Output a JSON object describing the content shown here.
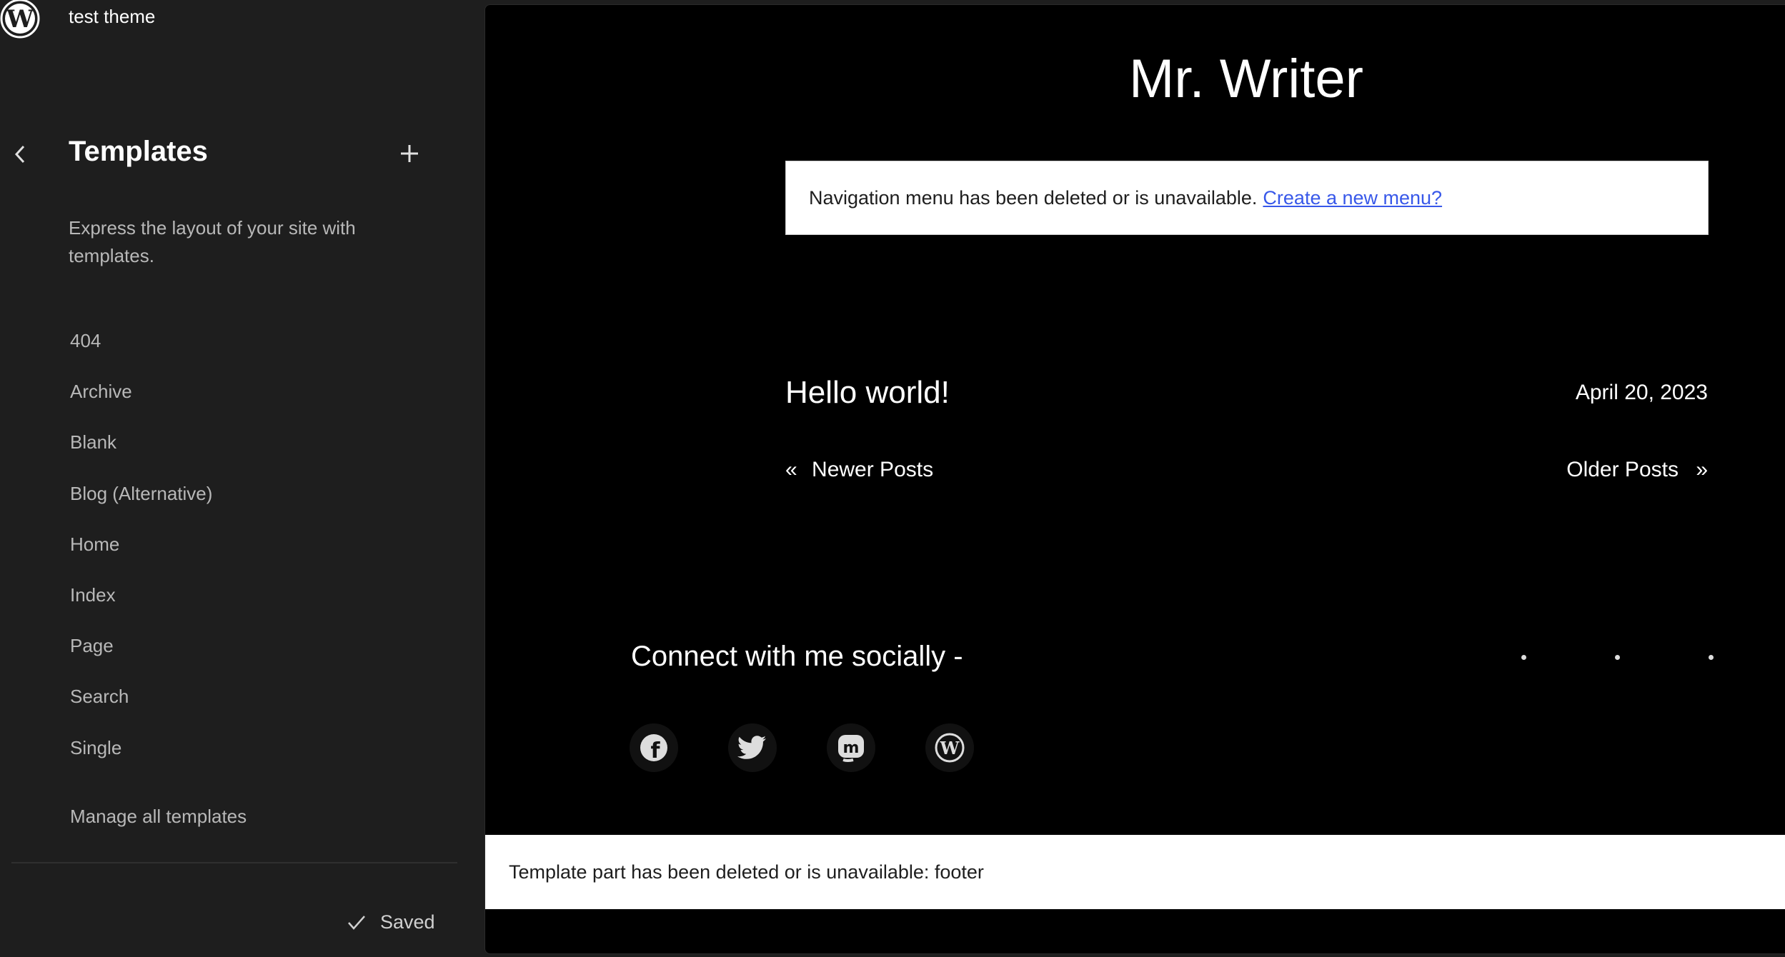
{
  "site_hub": {
    "site_title": "test theme",
    "logo_icon": "wordpress-logo-icon"
  },
  "sidebar": {
    "back_icon": "chevron-left-icon",
    "title": "Templates",
    "add_icon": "plus-icon",
    "description": "Express the layout of your site with templates.",
    "templates": [
      {
        "label": "404"
      },
      {
        "label": "Archive"
      },
      {
        "label": "Blank"
      },
      {
        "label": "Blog (Alternative)"
      },
      {
        "label": "Home"
      },
      {
        "label": "Index"
      },
      {
        "label": "Page"
      },
      {
        "label": "Search"
      },
      {
        "label": "Single"
      }
    ],
    "manage_label": "Manage all templates",
    "save_status": "Saved",
    "save_icon": "check-icon"
  },
  "preview": {
    "blog_title": "Mr. Writer",
    "nav_notice_text": "Navigation menu has been deleted or is unavailable.",
    "nav_notice_link": "Create a new menu?",
    "post_title": "Hello world!",
    "post_date": "April 20, 2023",
    "newer_posts": "Newer Posts",
    "newer_arrow": "«",
    "older_posts": "Older Posts",
    "older_arrow": "»",
    "social_heading": "Connect with me socially -",
    "social_icons": [
      "facebook-icon",
      "twitter-icon",
      "mastodon-icon",
      "wordpress-icon"
    ],
    "footer_notice": "Template part has been deleted or is unavailable: footer"
  },
  "colors": {
    "sidebar_bg": "#1e1e1e",
    "canvas_bg": "#000000",
    "link": "#3858e9",
    "notice_bg": "#ffffff"
  }
}
